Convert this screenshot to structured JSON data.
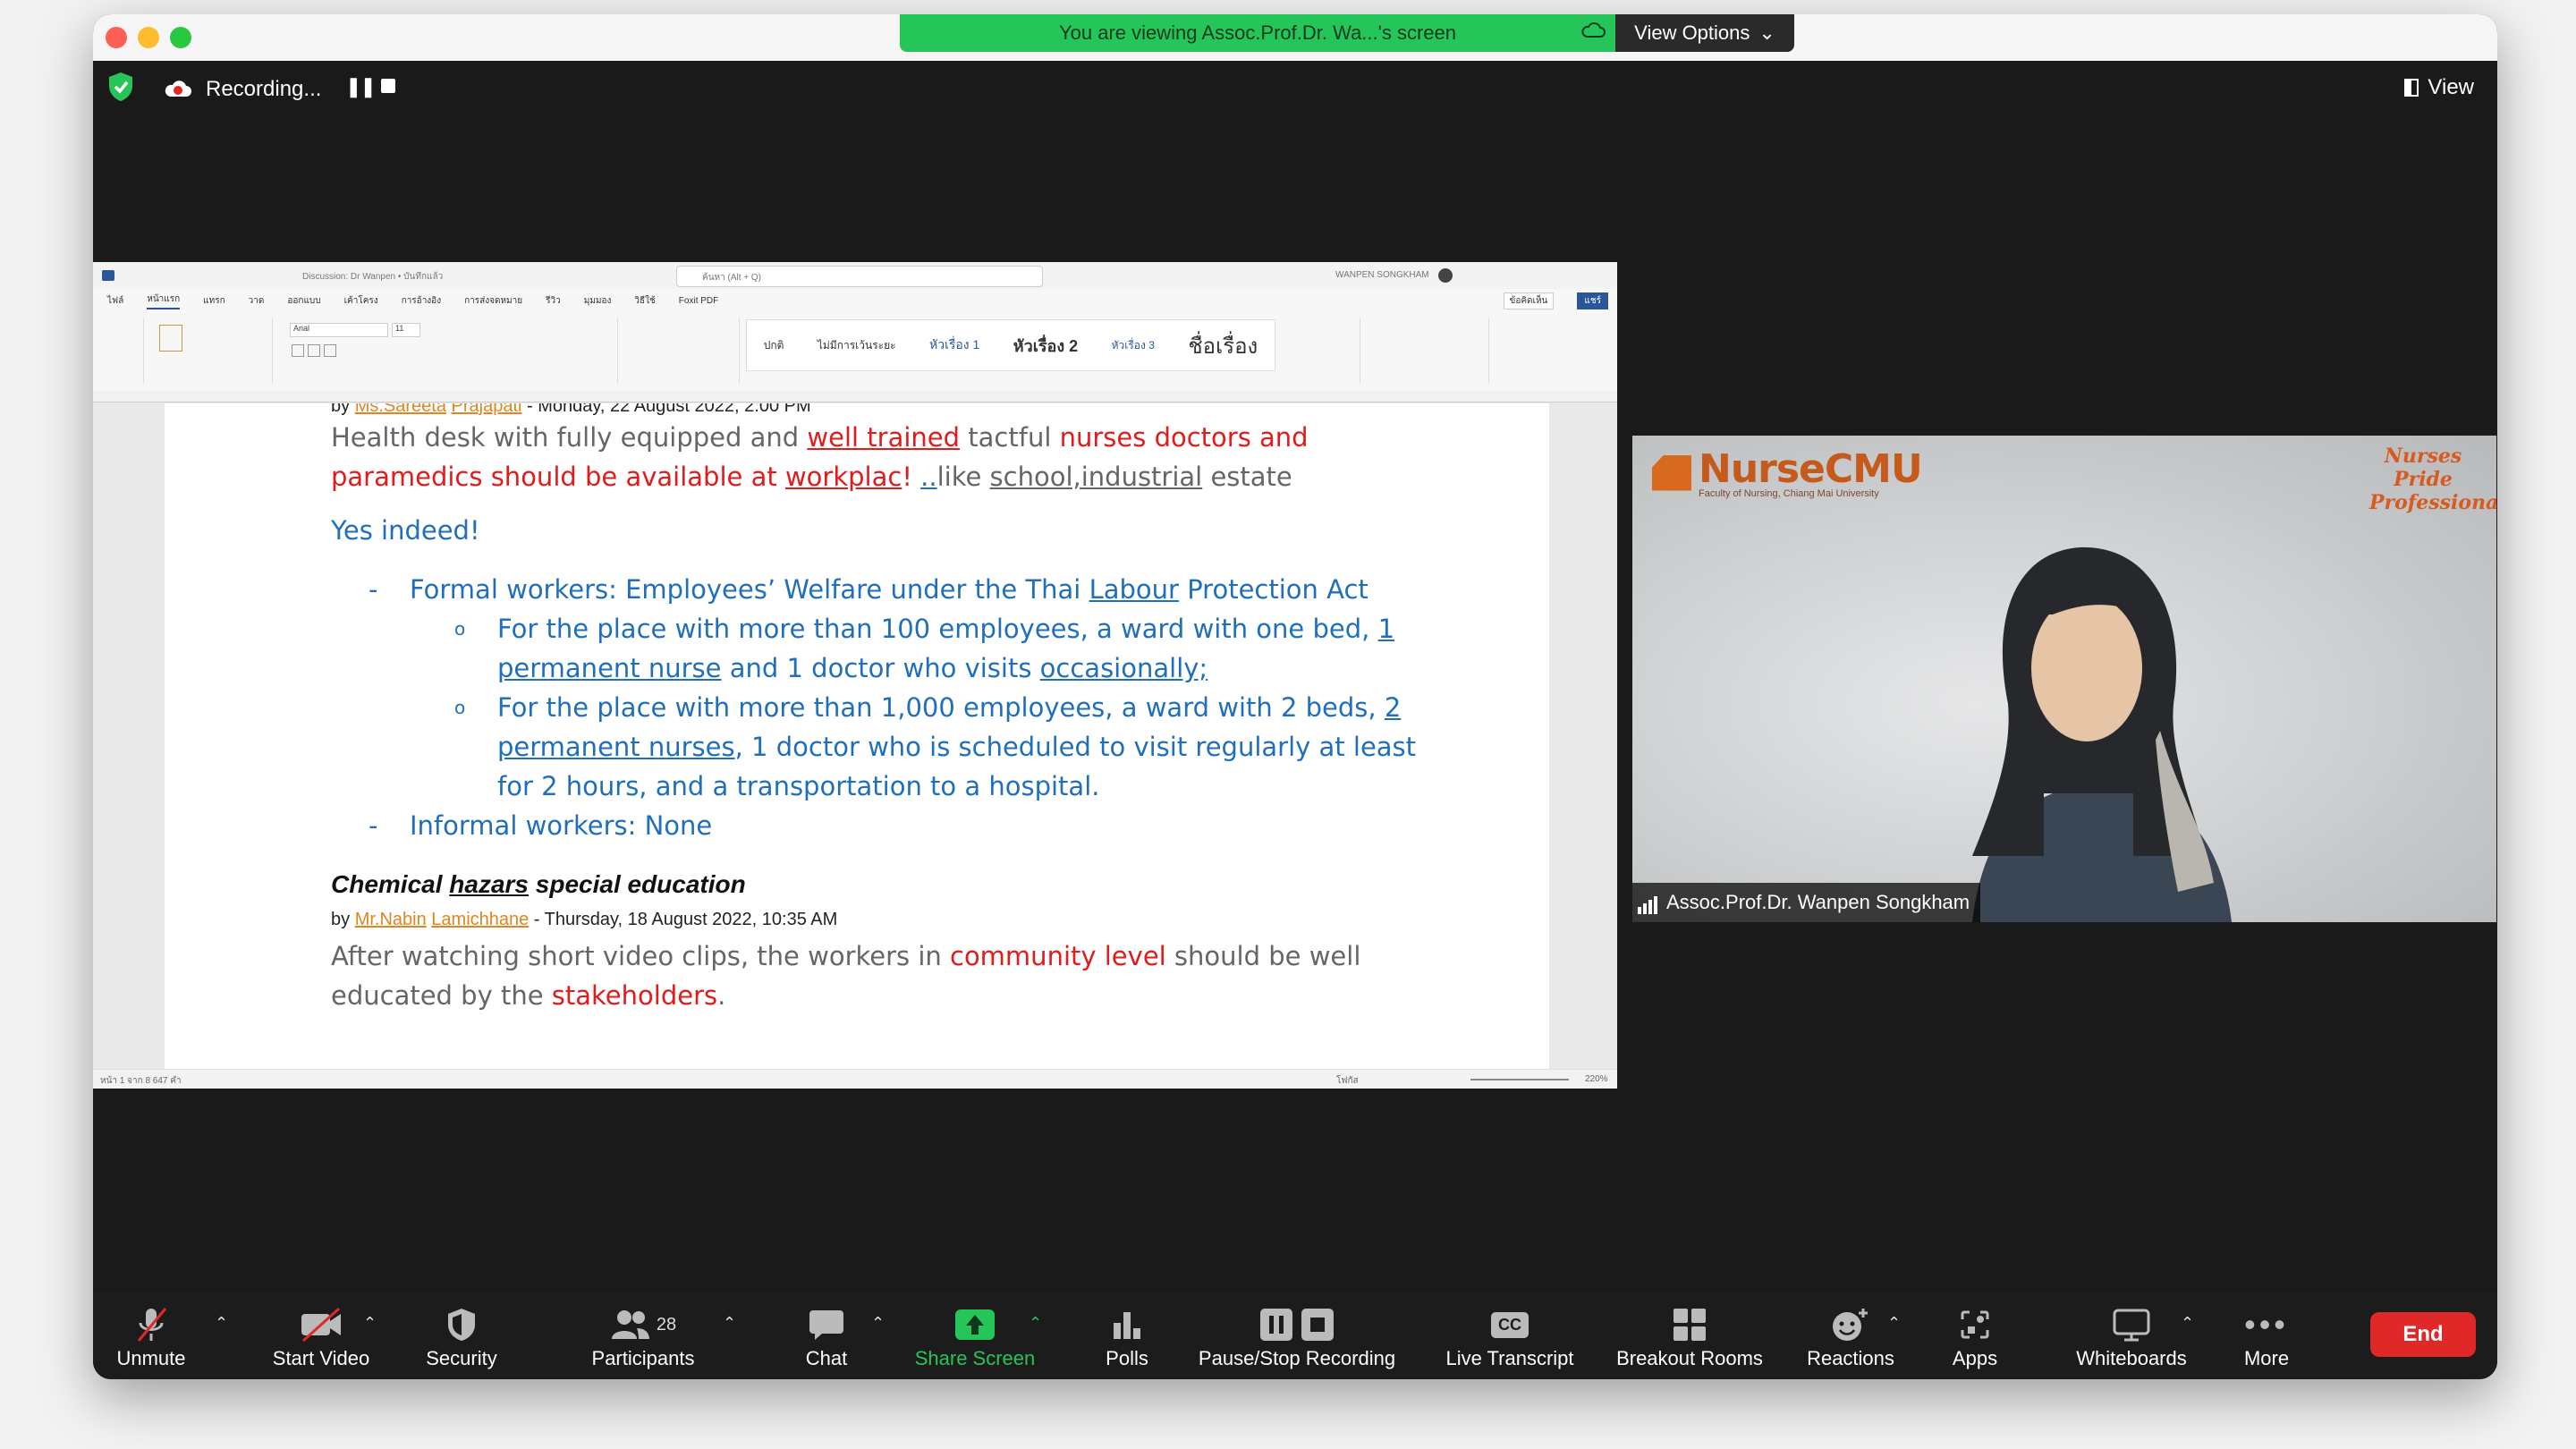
{
  "banner": {
    "message": "You are viewing Assoc.Prof.Dr. Wa...'s screen",
    "view_options": "View Options"
  },
  "topbar": {
    "recording": "Recording...",
    "view": "View"
  },
  "word": {
    "doc_title": "Discussion: Dr Wanpen • บันทึกแล้ว",
    "search_placeholder": "ค้นหา (Alt + Q)",
    "user": "WANPEN SONGKHAM",
    "menus": [
      "ไฟล์",
      "หน้าแรก",
      "แทรก",
      "วาด",
      "ออกแบบ",
      "เค้าโครง",
      "การอ้างอิง",
      "การส่งจดหมาย",
      "รีวิว",
      "มุมมอง",
      "วิธีใช้",
      "Foxit PDF"
    ],
    "font_name": "Arial",
    "font_size": "11",
    "styles": [
      "ปกติ",
      "ไม่มีการเว้นระยะ",
      "หัวเรื่อง 1",
      "หัวเรื่อง 2",
      "หัวเรื่อง 3",
      "ชื่อเรื่อง"
    ],
    "comment_btn": "ข้อคิดเห็น",
    "share_btn": "แชร์",
    "status_left": "หน้า 1 จาก 8    647 คำ",
    "status_right": "โฟกัส",
    "zoom": "220%"
  },
  "document": {
    "byline1_prefix": "by ",
    "byline1_author1": "Ms.Sareeta",
    "byline1_author2": "Prajapati",
    "byline1_date": " - Monday, 22 August 2022, 2:00 PM",
    "para1_a": "Health desk with fully equipped and ",
    "para1_b": "well trained",
    "para1_c": " tactful ",
    "para1_d": "nurses doctors and",
    "para1_e": "paramedics should be available at ",
    "para1_f": "workplac",
    "para1_g": "! ",
    "para1_h": "..",
    "para1_i": "like ",
    "para1_j": "school,industrial",
    "para1_k": " estate",
    "reply": "Yes indeed!",
    "bullet1_a": "Formal workers: Employees’ Welfare under the Thai ",
    "bullet1_b": "Labour",
    "bullet1_c": " Protection Act",
    "sub1_a": "For the place with more than 100 employees, a ward with one bed, ",
    "sub1_b": "1",
    "sub1_c": "permanent nurse",
    "sub1_d": " and 1 doctor who visits ",
    "sub1_e": "occasionally;",
    "sub2_a": "For the place with more than 1,000 employees, a ward with 2 beds, ",
    "sub2_b": "2",
    "sub2_c": "permanent nurses",
    "sub2_d": ", 1 doctor who is scheduled to visit regularly at least",
    "sub2_e": "for 2 hours, and a transportation to a hospital.",
    "bullet2": "Informal workers: None",
    "heading_a": "Chemical ",
    "heading_b": "hazars",
    "heading_c": " special education",
    "byline2_prefix": "by ",
    "byline2_author1": "Mr.Nabin",
    "byline2_author2": "Lamichhane",
    "byline2_date": " - Thursday, 18 August 2022, 10:35 AM",
    "para2_a": "After watching short video clips, the workers in ",
    "para2_b": "community level",
    "para2_c": " should be well",
    "para2_d": "educated by the ",
    "para2_e": "stakeholders",
    "para2_f": "."
  },
  "video": {
    "logo": "NurseCMU",
    "logo_sub": "Faculty of Nursing, Chiang Mai University",
    "pride_text": "Nurses Pride Professionalism",
    "participant": "Assoc.Prof.Dr. Wanpen Songkham"
  },
  "toolbar": {
    "unmute": "Unmute",
    "start_video": "Start Video",
    "security": "Security",
    "participants": "Participants",
    "participant_count": "28",
    "chat": "Chat",
    "share_screen": "Share Screen",
    "polls": "Polls",
    "pause_stop": "Pause/Stop Recording",
    "live_transcript": "Live Transcript",
    "breakout_rooms": "Breakout Rooms",
    "reactions": "Reactions",
    "apps": "Apps",
    "whiteboards": "Whiteboards",
    "more": "More",
    "end": "End",
    "cc": "CC"
  },
  "colors": {
    "accent_green": "#25c55a",
    "end_red": "#e02828",
    "word_blue": "#2b579a",
    "doc_red": "#e21b1b",
    "doc_blue": "#1f6fbd"
  }
}
